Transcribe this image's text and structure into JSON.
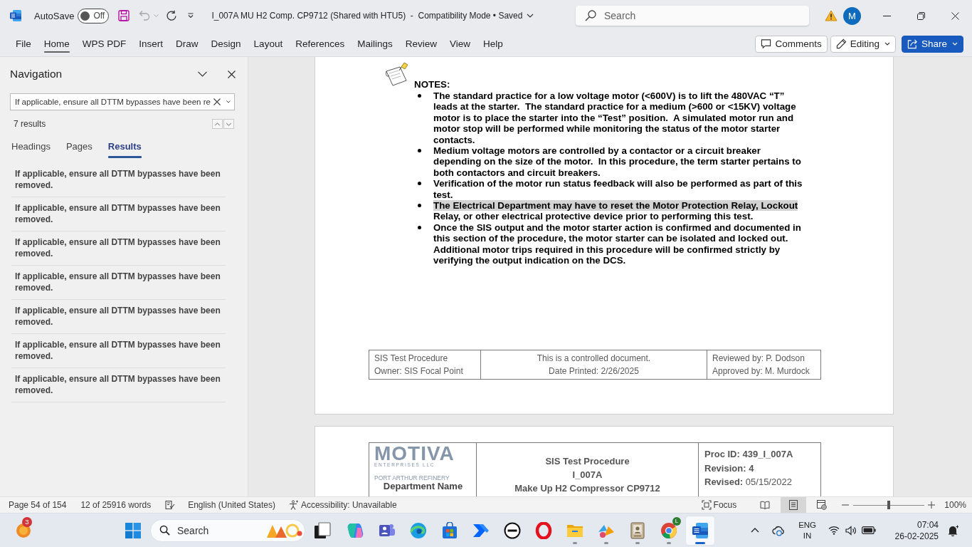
{
  "title_bar": {
    "autosave": {
      "label": "AutoSave",
      "state_label": "Off",
      "on": false
    },
    "undo": {
      "disabled": true
    },
    "document_title": "I_007A MU H2 Comp. CP9712 (Shared with HTU5)  -  Compatibility Mode • Saved",
    "search": {
      "placeholder": "Search"
    },
    "account_initial": "M"
  },
  "ribbon": {
    "tabs": [
      {
        "label": "File",
        "selected": false
      },
      {
        "label": "Home",
        "selected": true
      },
      {
        "label": "WPS PDF",
        "selected": false
      },
      {
        "label": "Insert",
        "selected": false
      },
      {
        "label": "Draw",
        "selected": false
      },
      {
        "label": "Design",
        "selected": false
      },
      {
        "label": "Layout",
        "selected": false
      },
      {
        "label": "References",
        "selected": false
      },
      {
        "label": "Mailings",
        "selected": false
      },
      {
        "label": "Review",
        "selected": false
      },
      {
        "label": "View",
        "selected": false
      },
      {
        "label": "Help",
        "selected": false
      }
    ],
    "comments": "Comments",
    "editing": "Editing",
    "share": "Share"
  },
  "navigation": {
    "title": "Navigation",
    "search": {
      "value": "If applicable, ensure all DTTM bypasses have been re"
    },
    "result_count": "7 results",
    "tabs": [
      {
        "label": "Headings",
        "selected": false
      },
      {
        "label": "Pages",
        "selected": false
      },
      {
        "label": "Results",
        "selected": true
      }
    ],
    "results": [
      {
        "text": "If applicable, ensure all DTTM bypasses have been removed.",
        "selected": false
      },
      {
        "text": "If applicable, ensure all DTTM bypasses have been removed.",
        "selected": false
      },
      {
        "text": "If applicable, ensure all DTTM bypasses have been removed.",
        "selected": false
      },
      {
        "text": "If applicable, ensure all DTTM bypasses have been removed.",
        "selected": false
      },
      {
        "text": "If applicable, ensure all DTTM bypasses have been removed.",
        "selected": false
      },
      {
        "text": "If applicable, ensure all DTTM bypasses have been removed.",
        "selected": false
      },
      {
        "text": "If applicable, ensure all DTTM bypasses have been removed.",
        "selected": false
      }
    ]
  },
  "document": {
    "notes_heading": "NOTES:",
    "notes": [
      {
        "segments": [
          {
            "text": "The standard practice for a low voltage motor (<600V) is to lift the 480VAC “T” leads at the starter.  The standard practice for a medium (>600 or <15KV) voltage motor is to place the starter into the “Test” position.  A simulated motor run and motor stop will be performed while monitoring the status of the motor starter contacts.",
            "highlighted": false
          }
        ]
      },
      {
        "segments": [
          {
            "text": "Medium voltage motors are controlled by a contactor or a circuit breaker depending on the size of the motor.  In this procedure, the term starter pertains to both contactors and circuit breakers.",
            "highlighted": false
          }
        ]
      },
      {
        "segments": [
          {
            "text": "Verification of the motor run status feedback will also be performed as part of this test.",
            "highlighted": false
          }
        ]
      },
      {
        "segments": [
          {
            "text": "The Electrical Department may have to reset the Motor Protection Relay, Lockout",
            "highlighted": true
          },
          {
            "text": " Relay, or other electrical protective device prior to performing this test.",
            "highlighted": false
          }
        ]
      },
      {
        "segments": [
          {
            "text": "Once the SIS output and the motor starter action is confirmed and documented in this section of the procedure, the motor starter can be isolated and locked out.  Additional motor trips required in this procedure will be confirmed strictly by verifying the output indication on the DCS.",
            "highlighted": false
          }
        ]
      }
    ],
    "footer": {
      "cells": [
        [
          "SIS Test Procedure",
          "Owner: SIS Focal Point"
        ],
        [
          "This is a controlled document.",
          "Date Printed: 2/26/2025"
        ],
        [
          "Reviewed by: P. Dodson",
          "Approved by: M. Murdock"
        ]
      ]
    },
    "next_page_header": {
      "logo": {
        "name": "MOTIVA",
        "subtitle": "ENTERPRISES LLC",
        "site": "PORT ARTHUR REFINERY",
        "department": "Department Name"
      },
      "title_lines": [
        "SIS Test Procedure",
        "I_007A",
        "Make Up H2 Compressor CP9712"
      ],
      "details": [
        {
          "label": "Proc ID:",
          "value": "439_I_007A",
          "value_bold": true
        },
        {
          "label": "Revision:",
          "value": "4",
          "value_bold": true
        },
        {
          "label": "Revised:",
          "value": "05/15/2022",
          "value_bold": false
        }
      ]
    }
  },
  "status_bar": {
    "page": "Page 54 of 154",
    "words": "12 of 25916 words",
    "language": "English (United States)",
    "accessibility": "Accessibility: Unavailable",
    "focus": "Focus",
    "views": [
      {
        "kind": "read",
        "selected": false
      },
      {
        "kind": "print",
        "selected": true
      },
      {
        "kind": "web",
        "selected": false
      }
    ],
    "zoom": {
      "level": 0.5
    },
    "zoom_value": "100%"
  },
  "taskbar": {
    "weather_badge": "3",
    "search": {
      "placeholder": "Search"
    },
    "apps": [
      {
        "kind": "squares",
        "running": false,
        "active": false
      },
      {
        "kind": "swirl",
        "running": false,
        "active": false
      },
      {
        "kind": "people",
        "running": false,
        "active": false
      },
      {
        "kind": "wave",
        "running": false,
        "active": false
      },
      {
        "kind": "bag",
        "running": false,
        "active": false
      },
      {
        "kind": "arrow",
        "running": false,
        "active": false
      },
      {
        "kind": "disc",
        "running": false,
        "active": false
      },
      {
        "kind": "ring",
        "running": false,
        "active": false
      },
      {
        "kind": "folder",
        "running": true,
        "active": false
      },
      {
        "kind": "shapes",
        "running": true,
        "active": false
      },
      {
        "kind": "frame",
        "running": true,
        "active": false
      },
      {
        "kind": "tricolor",
        "running": true,
        "active": false,
        "badge": "L"
      },
      {
        "kind": "document",
        "running": true,
        "active": true
      }
    ],
    "input_language": "ENG",
    "input_region": "IN",
    "time": "07:04",
    "date": "26-02-2025"
  }
}
